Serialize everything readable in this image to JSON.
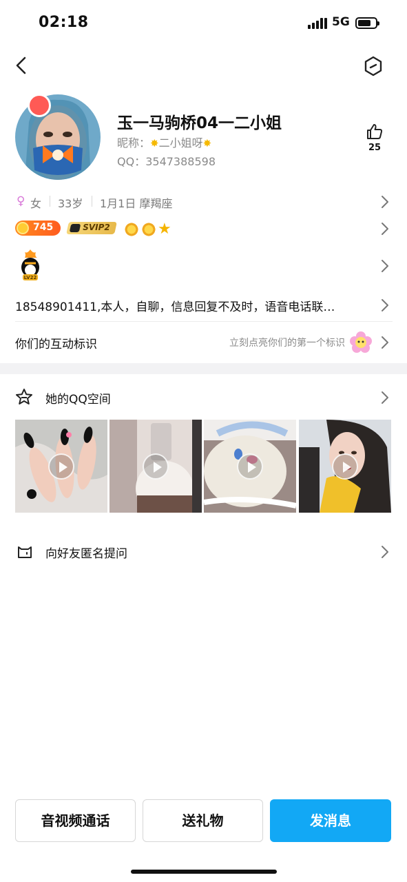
{
  "status_bar": {
    "time": "02:18",
    "network": "5G"
  },
  "profile": {
    "name": "玉一马驹桥04一二小姐",
    "nickname_prefix": "昵称：",
    "nickname": "二小姐呀",
    "qq_label": "QQ：",
    "qq_number": "3547388598",
    "likes": "25"
  },
  "info": {
    "gender": "女",
    "age": "33岁",
    "birthday_sign": "1月1日  摩羯座"
  },
  "badges": {
    "coin_value": "745",
    "svip_label": "SVIP2",
    "level_label": "LV22"
  },
  "signature": "18548901411,本人，自聊，信息回复不及时，语音电话联…",
  "interaction": {
    "label": "你们的互动标识",
    "hint": "立刻点亮你们的第一个标识"
  },
  "qzone": {
    "label": "她的QQ空间"
  },
  "ask": {
    "label": "向好友匿名提问"
  },
  "actions": {
    "call": "音视频通话",
    "gift": "送礼物",
    "message": "发消息"
  },
  "colors": {
    "primary": "#12a8f5",
    "gender": "#d878d8",
    "coin": "#ff6a1f",
    "svip": "#e7b94a"
  }
}
